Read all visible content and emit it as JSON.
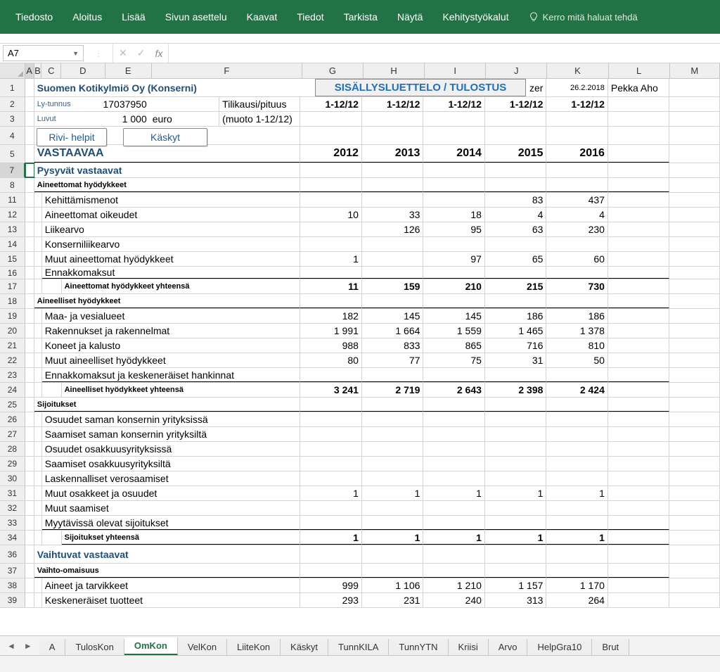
{
  "ribbon": {
    "tabs": [
      "Tiedosto",
      "Aloitus",
      "Lisää",
      "Sivun asettelu",
      "Kaavat",
      "Tiedot",
      "Tarkista",
      "Näytä",
      "Kehitystyökalut"
    ],
    "tell_me": "Kerro mitä haluat tehdä"
  },
  "namebox": "A7",
  "columns": [
    "A",
    "B",
    "C",
    "D",
    "E",
    "F",
    "G",
    "H",
    "I",
    "J",
    "K",
    "L",
    "M"
  ],
  "row_nums": [
    "1",
    "2",
    "3",
    "4",
    "5",
    "7",
    "8",
    "11",
    "12",
    "13",
    "14",
    "15",
    "16",
    "17",
    "18",
    "19",
    "20",
    "21",
    "22",
    "23",
    "24",
    "25",
    "26",
    "27",
    "28",
    "29",
    "30",
    "31",
    "32",
    "33",
    "34",
    "36",
    "37",
    "38",
    "39"
  ],
  "buttons": {
    "rivi_helpit": "Rivi- helpit",
    "kaskyt": "Käskyt",
    "sisalto": "SISÄLLYSLUETTELO / TULOSTUS"
  },
  "header": {
    "company": "Suomen Kotikylmiö Oy (Konserni)",
    "zer": "zer",
    "date": "26.2.2018",
    "author": "Pekka Aho",
    "ly_label": "Ly-tunnus",
    "ly": "17037950",
    "tilikausi_label": "Tilikausi/pituus",
    "periods": [
      "1-12/12",
      "1-12/12",
      "1-12/12",
      "1-12/12",
      "1-12/12"
    ],
    "luvut_label": "Luvut",
    "luvut_val": "1 000",
    "luvut_unit": "euro",
    "muoto": "(muoto 1-12/12)",
    "vastaavaa": "VASTAAVAA",
    "years": [
      "2012",
      "2013",
      "2014",
      "2015",
      "2016"
    ]
  },
  "sections": {
    "pysyvat": "Pysyvät vastaavat",
    "aineettomat_h": "Aineettomat hyödykkeet",
    "r11": {
      "label": "Kehittämismenot",
      "v": [
        "",
        "",
        "",
        "83",
        "437"
      ]
    },
    "r12": {
      "label": "Aineettomat oikeudet",
      "v": [
        "10",
        "33",
        "18",
        "4",
        "4"
      ]
    },
    "r13": {
      "label": "Liikearvo",
      "v": [
        "",
        "126",
        "95",
        "63",
        "230"
      ]
    },
    "r14": {
      "label": "Konserniliikearvo",
      "v": [
        "",
        "",
        "",
        "",
        ""
      ]
    },
    "r15": {
      "label": "Muut aineettomat hyödykkeet",
      "v": [
        "1",
        "",
        "97",
        "65",
        "60"
      ]
    },
    "r16": {
      "label": "Ennakkomaksut",
      "v": [
        "",
        "",
        "",
        "",
        ""
      ]
    },
    "r17": {
      "label": "Aineettomat hyödykkeet yhteensä",
      "v": [
        "11",
        "159",
        "210",
        "215",
        "730"
      ]
    },
    "aineelliset_h": "Aineelliset hyödykkeet",
    "r19": {
      "label": "Maa- ja vesialueet",
      "v": [
        "182",
        "145",
        "145",
        "186",
        "186"
      ]
    },
    "r20": {
      "label": "Rakennukset ja rakennelmat",
      "v": [
        "1 991",
        "1 664",
        "1 559",
        "1 465",
        "1 378"
      ]
    },
    "r21": {
      "label": "Koneet ja kalusto",
      "v": [
        "988",
        "833",
        "865",
        "716",
        "810"
      ]
    },
    "r22": {
      "label": "Muut aineelliset hyödykkeet",
      "v": [
        "80",
        "77",
        "75",
        "31",
        "50"
      ]
    },
    "r23": {
      "label": "Ennakkomaksut ja keskeneräiset hankinnat",
      "v": [
        "",
        "",
        "",
        "",
        ""
      ]
    },
    "r24": {
      "label": "Aineelliset hyödykkeet yhteensä",
      "v": [
        "3 241",
        "2 719",
        "2 643",
        "2 398",
        "2 424"
      ]
    },
    "sijoitukset_h": "Sijoitukset",
    "r26": {
      "label": "Osuudet saman konsernin yrityksissä"
    },
    "r27": {
      "label": "Saamiset saman konsernin yrityksiltä"
    },
    "r28": {
      "label": "Osuudet osakkuusyrityksissä"
    },
    "r29": {
      "label": "Saamiset osakkuusyrityksiltä"
    },
    "r30": {
      "label": "Laskennalliset verosaamiset"
    },
    "r31": {
      "label": "Muut osakkeet ja osuudet",
      "v": [
        "1",
        "1",
        "1",
        "1",
        "1"
      ]
    },
    "r32": {
      "label": "Muut saamiset"
    },
    "r33": {
      "label": "Myytävissä olevat sijoitukset"
    },
    "r34": {
      "label": "Sijoitukset yhteensä",
      "v": [
        "1",
        "1",
        "1",
        "1",
        "1"
      ]
    },
    "vaihtuvat": "Vaihtuvat vastaavat",
    "vaihto_h": "Vaihto-omaisuus",
    "r38": {
      "label": "Aineet ja tarvikkeet",
      "v": [
        "999",
        "1 106",
        "1 210",
        "1 157",
        "1 170"
      ]
    },
    "r39": {
      "label": "Keskeneräiset tuotteet",
      "v": [
        "293",
        "231",
        "240",
        "313",
        "264"
      ]
    }
  },
  "sheets": [
    "A",
    "TulosKon",
    "OmKon",
    "VelKon",
    "LiiteKon",
    "Käskyt",
    "TunnKILA",
    "TunnYTN",
    "Kriisi",
    "Arvo",
    "HelpGra10",
    "Brut"
  ],
  "active_sheet": 2
}
